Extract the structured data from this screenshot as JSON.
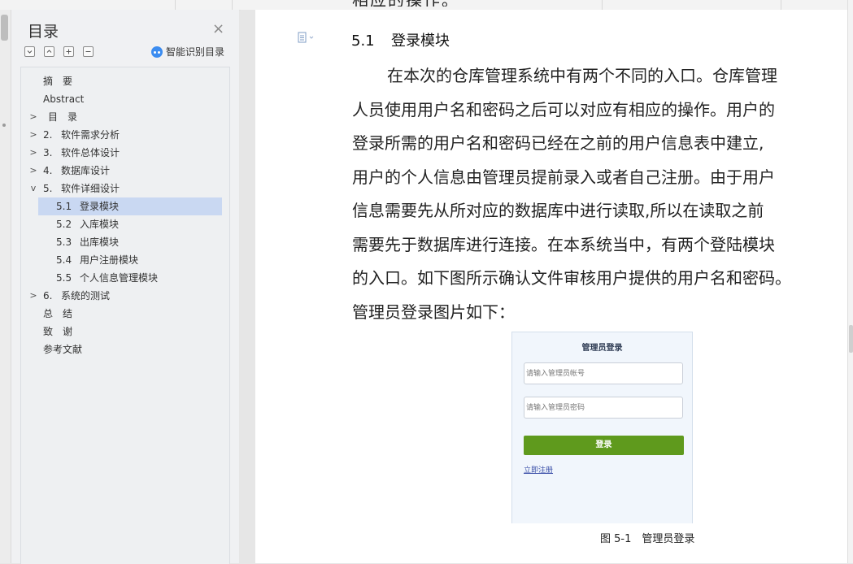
{
  "nav": {
    "title": "目录",
    "close_glyph": "×",
    "tools": [
      "collapse-all-icon",
      "expand-one-icon",
      "add-icon",
      "remove-icon"
    ],
    "smart_label": "智能识别目录",
    "items": [
      {
        "num": "",
        "label": "摘　要",
        "caret": ""
      },
      {
        "num": "",
        "label": "Abstract",
        "caret": ""
      },
      {
        "num": "",
        "label": "目　录",
        "caret": ">"
      },
      {
        "num": "2.",
        "label": "软件需求分析",
        "caret": ">"
      },
      {
        "num": "3.",
        "label": "软件总体设计",
        "caret": ">"
      },
      {
        "num": "4.",
        "label": "数据库设计",
        "caret": ">"
      },
      {
        "num": "5.",
        "label": "软件详细设计",
        "caret": "v"
      },
      {
        "num": "5.1",
        "label": "登录模块",
        "caret": ""
      },
      {
        "num": "5.2",
        "label": "入库模块",
        "caret": ""
      },
      {
        "num": "5.3",
        "label": "出库模块",
        "caret": ""
      },
      {
        "num": "5.4",
        "label": "用户注册模块",
        "caret": ""
      },
      {
        "num": "5.5",
        "label": "个人信息管理模块",
        "caret": ""
      },
      {
        "num": "6.",
        "label": "系统的测试",
        "caret": ">"
      },
      {
        "num": "",
        "label": "总　结",
        "caret": ""
      },
      {
        "num": "",
        "label": "致　谢",
        "caret": ""
      },
      {
        "num": "",
        "label": "参考文献",
        "caret": ""
      }
    ]
  },
  "doc": {
    "prev_line": "相应的操作。",
    "heading_num": "5.1",
    "heading_text": "登录模块",
    "paragraph": [
      "在本次的仓库管理系统中有两个不同的入口。仓库管理",
      "人员使用用户名和密码之后可以对应有相应的操作。用户的",
      "登录所需的用户名和密码已经在之前的用户信息表中建立,",
      "用户的个人信息由管理员提前录入或者自己注册。由于用户",
      "信息需要先从所对应的数据库中进行读取,所以在读取之前",
      "需要先于数据库进行连接。在本系统当中，有两个登陆模块",
      "的入口。如下图所示确认文件审核用户提供的用户名和密码。",
      "管理员登录图片如下："
    ],
    "figure": {
      "title": "管理员登录",
      "account_placeholder": "请输入管理员帐号",
      "password_placeholder": "请输入管理员密码",
      "login_label": "登录",
      "register_link": "立即注册"
    },
    "caption": "图 5-1　管理员登录"
  }
}
